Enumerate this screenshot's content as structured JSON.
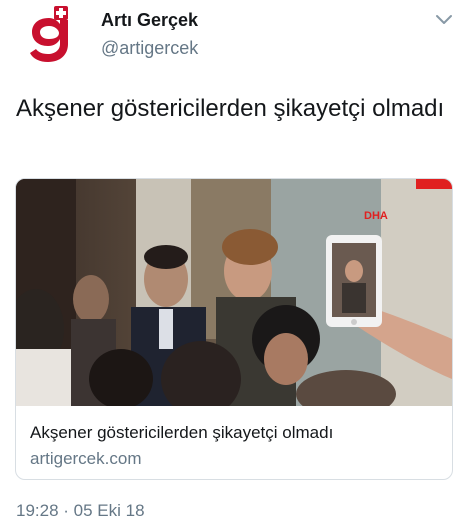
{
  "account": {
    "name": "Artı Gerçek",
    "handle": "@artigercek",
    "avatar_icon": "artigercek-logo-icon",
    "brand_color": "#c8102e"
  },
  "tweet": {
    "text": "Akşener göstericilerden şikayetçi olmadı"
  },
  "card": {
    "title": "Akşener göstericilerden şikayetçi olmadı",
    "domain": "artigercek.com",
    "image_watermark": "DHA"
  },
  "meta": {
    "timestamp": "19:28 · 05 Eki 18"
  },
  "icons": {
    "menu": "chevron-down-icon"
  }
}
